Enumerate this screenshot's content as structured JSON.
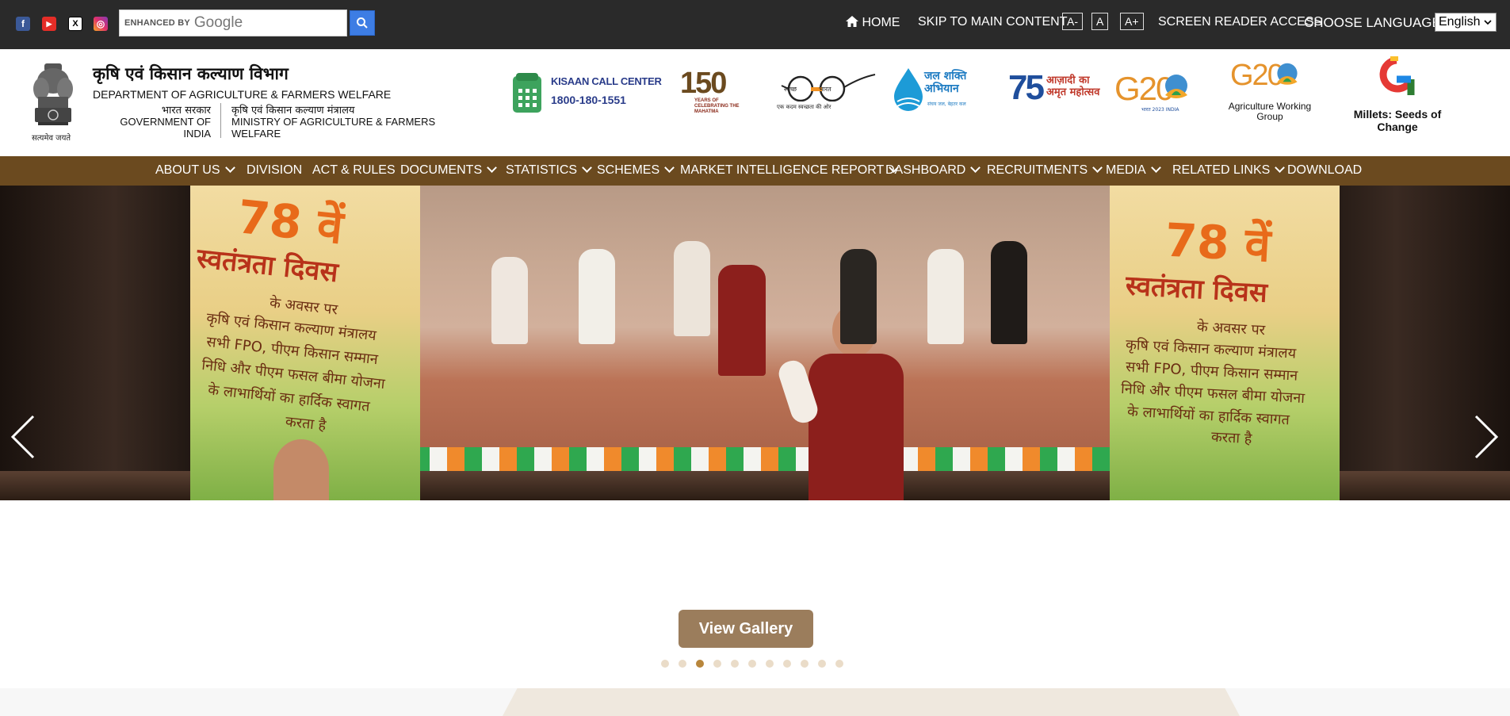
{
  "topbar": {
    "social": [
      {
        "name": "facebook",
        "icon": "facebook-icon",
        "color": "#3b5998",
        "glyph": "f"
      },
      {
        "name": "youtube",
        "icon": "youtube-icon",
        "color": "#e52d27",
        "glyph": "▶"
      },
      {
        "name": "x",
        "icon": "x-icon",
        "color": "#000000",
        "glyph": "X"
      },
      {
        "name": "instagram",
        "icon": "instagram-icon",
        "color": "#d6249f",
        "glyph": "◎"
      }
    ],
    "search": {
      "enhanced_by": "ENHANCED BY",
      "google": "Google"
    },
    "home_label": "HOME",
    "skip_label": "SKIP TO MAIN CONTENT",
    "font_small": "A-",
    "font_normal": "A",
    "font_large": "A+",
    "screen_reader": "SCREEN READER ACCESS",
    "choose_language": "CHOOSE LANGUAGE-",
    "language_selected": "English"
  },
  "header": {
    "emblem_caption": "सत्यमेव जयते",
    "dept_hindi": "कृषि एवं किसान कल्याण विभाग",
    "dept_english": "DEPARTMENT OF AGRICULTURE & FARMERS WELFARE",
    "gov_hindi": "भारत सरकार",
    "gov_english": "GOVERNMENT OF INDIA",
    "ministry_hindi": "कृषि एवं किसान कल्याण मंत्रालय",
    "ministry_english": "MINISTRY OF AGRICULTURE & FARMERS WELFARE",
    "logos": {
      "kisaan_title": "KISAAN CALL CENTER",
      "kisaan_phone": "1800-180-1551",
      "gandhi_num": "150",
      "gandhi_text": "YEARS OF CELEBRATING THE MAHATMA",
      "swachh_a": "स्वच्छ",
      "swachh_b": "भारत",
      "swachh_tag": "एक कदम स्वच्छता की ओर",
      "jal_title": "जल शक्ति अभियान",
      "jal_tag": "संचय जल, बेहतर कल",
      "azadi_num": "75",
      "azadi_text": "आज़ादी का अमृत महोत्सव",
      "g20_text": "G20",
      "g20_tag": "भारत 2023 INDIA",
      "awg_g20": "G20",
      "awg_text": "Agriculture Working Group",
      "millets_text": "Millets: Seeds of Change"
    }
  },
  "nav": {
    "items": [
      {
        "label": "ABOUT US",
        "dropdown": true
      },
      {
        "label": "DIVISION",
        "dropdown": false
      },
      {
        "label": "ACT & RULES",
        "dropdown": false
      },
      {
        "label": "DOCUMENTS",
        "dropdown": true
      },
      {
        "label": "STATISTICS",
        "dropdown": true
      },
      {
        "label": "SCHEMES",
        "dropdown": true
      },
      {
        "label": "MARKET INTELLIGENCE REPORT",
        "dropdown": true
      },
      {
        "label": "DASHBOARD",
        "dropdown": true
      },
      {
        "label": "RECRUITMENTS",
        "dropdown": true
      },
      {
        "label": "MEDIA",
        "dropdown": true
      },
      {
        "label": "RELATED LINKS",
        "dropdown": true
      },
      {
        "label": "DOWNLOAD",
        "dropdown": false
      }
    ]
  },
  "banner": {
    "left_num": "78 वें",
    "left_title": "स्वतंत्रता दिवस",
    "left_line1": "के अवसर पर",
    "left_line2": "कृषि एवं किसान कल्याण मंत्रालय",
    "left_line3": "सभी FPO, पीएम किसान सम्मान",
    "left_line4": "निधि और पीएम फसल बीमा योजना",
    "left_line5": "के लाभार्थियों का हार्दिक स्वागत",
    "left_line6": "करता है",
    "right_num": "78 वें",
    "right_title": "स्वतंत्रता दिवस",
    "right_line1": "के अवसर पर",
    "right_line2": "कृषि एवं किसान कल्याण मंत्रालय",
    "right_line3": "सभी FPO, पीएम किसान सम्मान",
    "right_line4": "निधि और पीएम फसल बीमा योजना",
    "right_line5": "के लाभार्थियों का हार्दिक स्वागत",
    "right_line6": "करता है"
  },
  "gallery": {
    "button_label": "View Gallery",
    "dots_total": 11,
    "active_index": 2
  }
}
